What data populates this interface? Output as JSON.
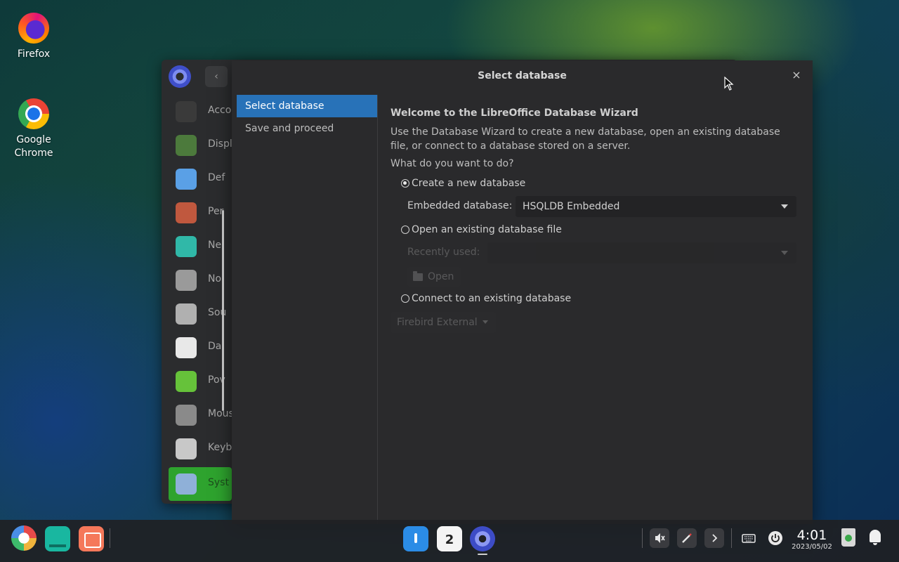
{
  "desktop": {
    "icons": [
      {
        "label": "Firefox"
      },
      {
        "label": "Google Chrome"
      }
    ]
  },
  "settings_window": {
    "back_symbol": "‹",
    "items": [
      {
        "label": "Accou",
        "icon": "account-icon",
        "color": "#3a3a3a"
      },
      {
        "label": "Displ",
        "icon": "display-icon",
        "color": "#4c7a3c"
      },
      {
        "label": "Def",
        "icon": "default-apps-icon",
        "color": "#5aa0e6"
      },
      {
        "label": "Per",
        "icon": "personalization-icon",
        "color": "#c0583e"
      },
      {
        "label": "Ne",
        "icon": "network-icon",
        "color": "#30b8a8"
      },
      {
        "label": "No",
        "icon": "notification-icon",
        "color": "#9a9a9a"
      },
      {
        "label": "Sou",
        "icon": "sound-icon",
        "color": "#b0b0b0"
      },
      {
        "label": "Da",
        "icon": "clock-icon",
        "color": "#e8e8e8"
      },
      {
        "label": "Pov",
        "icon": "power-icon",
        "color": "#66c23a"
      },
      {
        "label": "Mous",
        "icon": "mouse-icon",
        "color": "#8a8a8a"
      },
      {
        "label": "Keyb",
        "icon": "keyboard-icon",
        "color": "#c8c8c8"
      },
      {
        "label": "Syst",
        "icon": "system-info-icon",
        "color": "#8fb0d8",
        "active": true
      }
    ]
  },
  "dialog": {
    "title": "Select database",
    "close_symbol": "×",
    "steps": [
      {
        "label": "Select database",
        "active": true
      },
      {
        "label": "Save and proceed",
        "active": false
      }
    ],
    "heading": "Welcome to the LibreOffice Database Wizard",
    "description": "Use the Database Wizard to create a new database, open an existing database file, or connect to a database stored on a server.",
    "question": "What do you want to do?",
    "option_create": "Create a new database",
    "embedded_label": "Embedded database:",
    "embedded_value": "HSQLDB Embedded",
    "option_open": "Open an existing database file",
    "recent_label": "Recently used:",
    "recent_value": "",
    "open_button": "Open",
    "option_connect": "Connect to an existing database",
    "connect_value": "Firebird External",
    "selected_option": "create"
  },
  "taskbar": {
    "calendar_day": "2",
    "clock_time": "4:01",
    "clock_date": "2023/05/02"
  },
  "colors": {
    "accent_blue": "#2872b8",
    "settings_active_green": "#2ea32e"
  }
}
